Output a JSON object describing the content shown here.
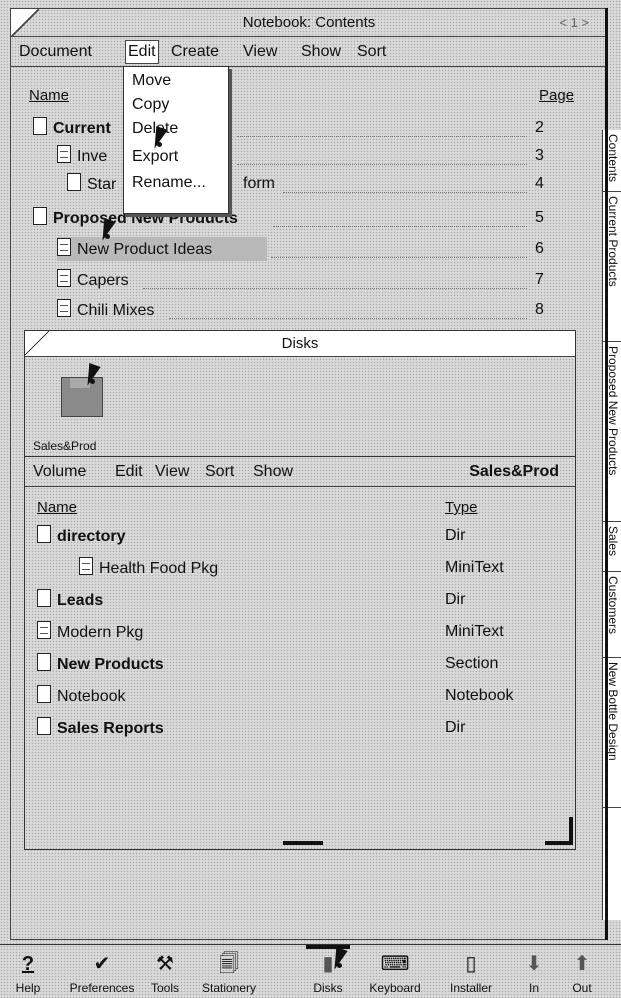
{
  "notebook": {
    "title": "Notebook: Contents",
    "page_indicator": "< 1 >",
    "menu": [
      "Document",
      "Edit",
      "Create",
      "View",
      "Show",
      "Sort"
    ],
    "columns": {
      "name": "Name",
      "page": "Page"
    },
    "rows": [
      {
        "label": "Current",
        "page": "2"
      },
      {
        "label": "Inve",
        "page": "3"
      },
      {
        "label": "Star",
        "suffix": "form",
        "page": "4"
      },
      {
        "label": "Proposed New Products",
        "page": "5"
      },
      {
        "label": "New Product Ideas",
        "page": "6"
      },
      {
        "label": "Capers",
        "page": "7"
      },
      {
        "label": "Chili Mixes",
        "page": "8"
      }
    ]
  },
  "edit_menu": [
    "Move",
    "Copy",
    "Delete",
    "Export",
    "Rename..."
  ],
  "side_tabs": [
    "Contents",
    "Current Products",
    "Proposed New Products",
    "Sales",
    "Customers",
    "New Bottle Design"
  ],
  "disks": {
    "title": "Disks",
    "disk_label": "Sales&Prod",
    "menu": [
      "Volume",
      "Edit",
      "View",
      "Sort",
      "Show"
    ],
    "current_volume": "Sales&Prod",
    "columns": {
      "name": "Name",
      "type": "Type"
    },
    "items": [
      {
        "name": "directory",
        "type": "Dir"
      },
      {
        "name": "Health Food Pkg",
        "type": "MiniText"
      },
      {
        "name": "Leads",
        "type": "Dir"
      },
      {
        "name": "Modern Pkg",
        "type": "MiniText"
      },
      {
        "name": "New Products",
        "type": "Section"
      },
      {
        "name": "Notebook",
        "type": "Notebook"
      },
      {
        "name": "Sales Reports",
        "type": "Dir"
      }
    ]
  },
  "toolbar": [
    {
      "label": "Help",
      "icon": "?"
    },
    {
      "label": "Preferences",
      "icon": "✔"
    },
    {
      "label": "Tools",
      "icon": "⚒"
    },
    {
      "label": "Stationery",
      "icon": "🗐"
    },
    {
      "label": "Disks",
      "icon": "▮"
    },
    {
      "label": "Keyboard",
      "icon": "⌨"
    },
    {
      "label": "Installer",
      "icon": "▯"
    },
    {
      "label": "In",
      "icon": "⬇"
    },
    {
      "label": "Out",
      "icon": "⬆"
    }
  ]
}
